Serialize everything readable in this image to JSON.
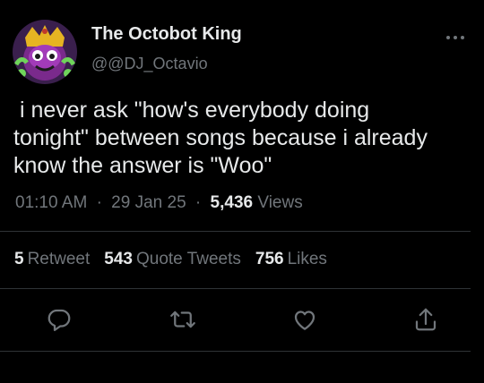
{
  "author": {
    "display_name": "The Octobot King",
    "handle": "@@DJ_Octavio",
    "avatar_icon": "octobot-king-avatar"
  },
  "tweet": {
    "text_lines": [
      " i never ask \"how's everybody doing",
      "tonight\" between songs because i already",
      "know the answer is \"Woo\""
    ]
  },
  "meta": {
    "time": "01:10 AM",
    "separator": "·",
    "date": "29 Jan 25",
    "views_count": "5,436",
    "views_label": "Views"
  },
  "stats": {
    "retweets_count": "5",
    "retweets_label": "Retweet",
    "quotes_count": "543",
    "quotes_label": "Quote Tweets",
    "likes_count": "756",
    "likes_label": "Likes"
  },
  "actions": {
    "reply_icon": "reply-icon",
    "retweet_icon": "retweet-icon",
    "like_icon": "like-icon",
    "share_icon": "share-icon"
  },
  "colors": {
    "background": "#000000",
    "text": "#e7e9ea",
    "secondary": "#71767b",
    "divider": "#2f3336"
  }
}
